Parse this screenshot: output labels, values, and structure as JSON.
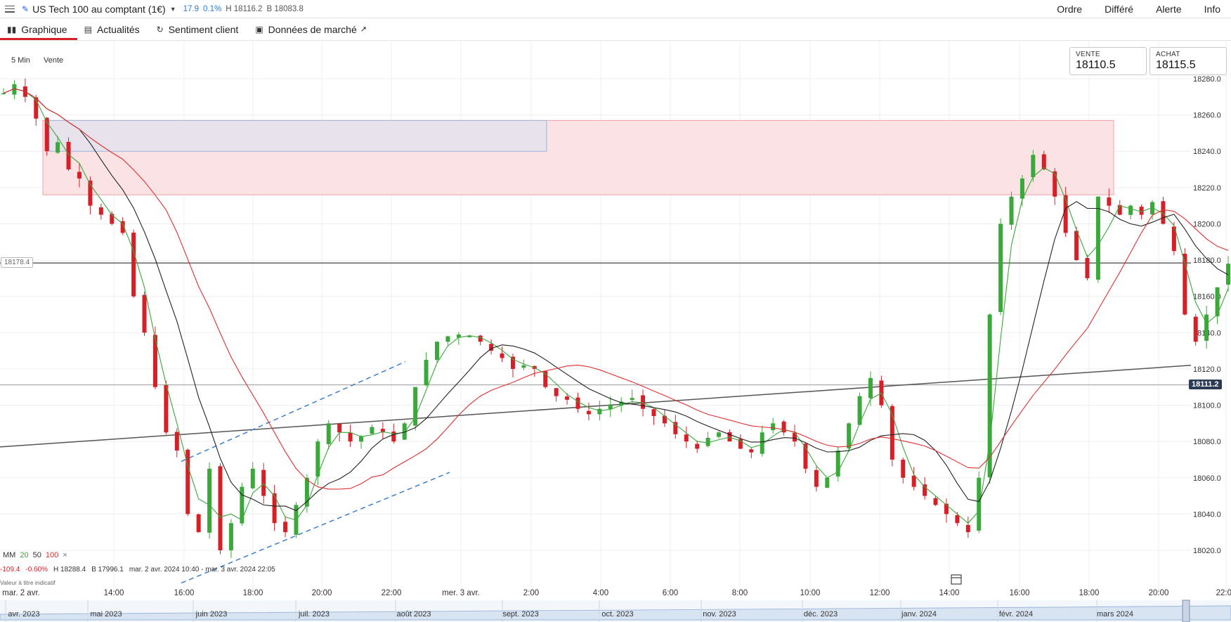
{
  "topbar": {
    "instrument": "US Tech 100 au comptant (1€)",
    "change": "17.9",
    "change_pct": "0.1%",
    "high": "H 18116.2",
    "low": "B 18083.8",
    "actions": [
      "Ordre",
      "Différé",
      "Alerte",
      "Info"
    ]
  },
  "tabs": [
    {
      "label": "Graphique",
      "icon": "bar-chart-icon",
      "active": true
    },
    {
      "label": "Actualités",
      "icon": "newspaper-icon",
      "active": false
    },
    {
      "label": "Sentiment client",
      "icon": "refresh-icon",
      "active": false
    },
    {
      "label": "Données de marché",
      "icon": "document-icon",
      "active": false
    }
  ],
  "chart": {
    "interval": "5 Min",
    "price_type": "Vente",
    "sell": {
      "label": "VENTE",
      "value": "18110.5"
    },
    "buy": {
      "label": "ACHAT",
      "value": "18115.5"
    },
    "current_price": "18111.2",
    "left_marker": "18178.4",
    "ma_legend": {
      "label": "MM",
      "periods": [
        "20",
        "50",
        "100"
      ],
      "close": "×"
    },
    "info": {
      "change": "-109.4",
      "change_pct": "-0.60%",
      "high": "H 18288.4",
      "low": "B 17996.1",
      "range": "mar. 2 avr. 2024 10:40 - mar. 3 avr. 2024 22:05"
    },
    "note": "Valeur à titre indicatif",
    "colors": {
      "up": "#3aa83a",
      "down": "#d71f27",
      "ma20": "#3aa83a",
      "ma50": "#222222",
      "ma100": "#e03030",
      "zone": "#f7c9cd",
      "accent": "#d71f27"
    }
  },
  "chart_data": {
    "type": "candlestick",
    "ylim": [
      18010,
      18290
    ],
    "yticks": [
      "18280.0",
      "18260.0",
      "18240.0",
      "18220.0",
      "18200.0",
      "18180.0",
      "18160.0",
      "18140.0",
      "18120.0",
      "18100.0",
      "18080.0",
      "18060.0",
      "18040.0",
      "18020.0"
    ],
    "xticks": [
      "mar. 2 avr.",
      "14:00",
      "16:00",
      "18:00",
      "20:00",
      "22:00",
      "mer. 3 avr.",
      "2:00",
      "4:00",
      "6:00",
      "8:00",
      "10:00",
      "12:00",
      "14:00",
      "16:00",
      "18:00",
      "20:00",
      "22:00"
    ],
    "navigator": [
      "avr. 2023",
      "mai 2023",
      "juin 2023",
      "juil. 2023",
      "août 2023",
      "sept. 2023",
      "oct. 2023",
      "nov. 2023",
      "déc. 2023",
      "janv. 2024",
      "févr. 2024",
      "mars 2024"
    ],
    "closes": [
      18272,
      18277,
      18270,
      18258,
      18240,
      18245,
      18230,
      18225,
      18210,
      18205,
      18200,
      18195,
      18160,
      18140,
      18110,
      18085,
      18075,
      18040,
      18030,
      18065,
      18020,
      18035,
      18055,
      18065,
      18050,
      18035,
      18030,
      18045,
      18060,
      18080,
      18090,
      18085,
      18080,
      18083,
      18088,
      18085,
      18080,
      18090,
      18110,
      18125,
      18135,
      18138,
      18139,
      18138,
      18135,
      18130,
      18126,
      18120,
      18122,
      18120,
      18110,
      18105,
      18103,
      18098,
      18095,
      18098,
      18100,
      18102,
      18104,
      18098,
      18094,
      18090,
      18084,
      18080,
      18076,
      18082,
      18085,
      18080,
      18076,
      18074,
      18085,
      18090,
      18085,
      18080,
      18065,
      18055,
      18060,
      18075,
      18090,
      18105,
      18115,
      18100,
      18070,
      18060,
      18055,
      18050,
      18045,
      18040,
      18035,
      18030,
      18060,
      18150,
      18200,
      18215,
      18225,
      18238,
      18230,
      18215,
      18195,
      18180,
      18170,
      18215,
      18210,
      18205,
      18210,
      18205,
      18212,
      18200,
      18185,
      18150,
      18135,
      18150,
      18165,
      18178
    ]
  }
}
